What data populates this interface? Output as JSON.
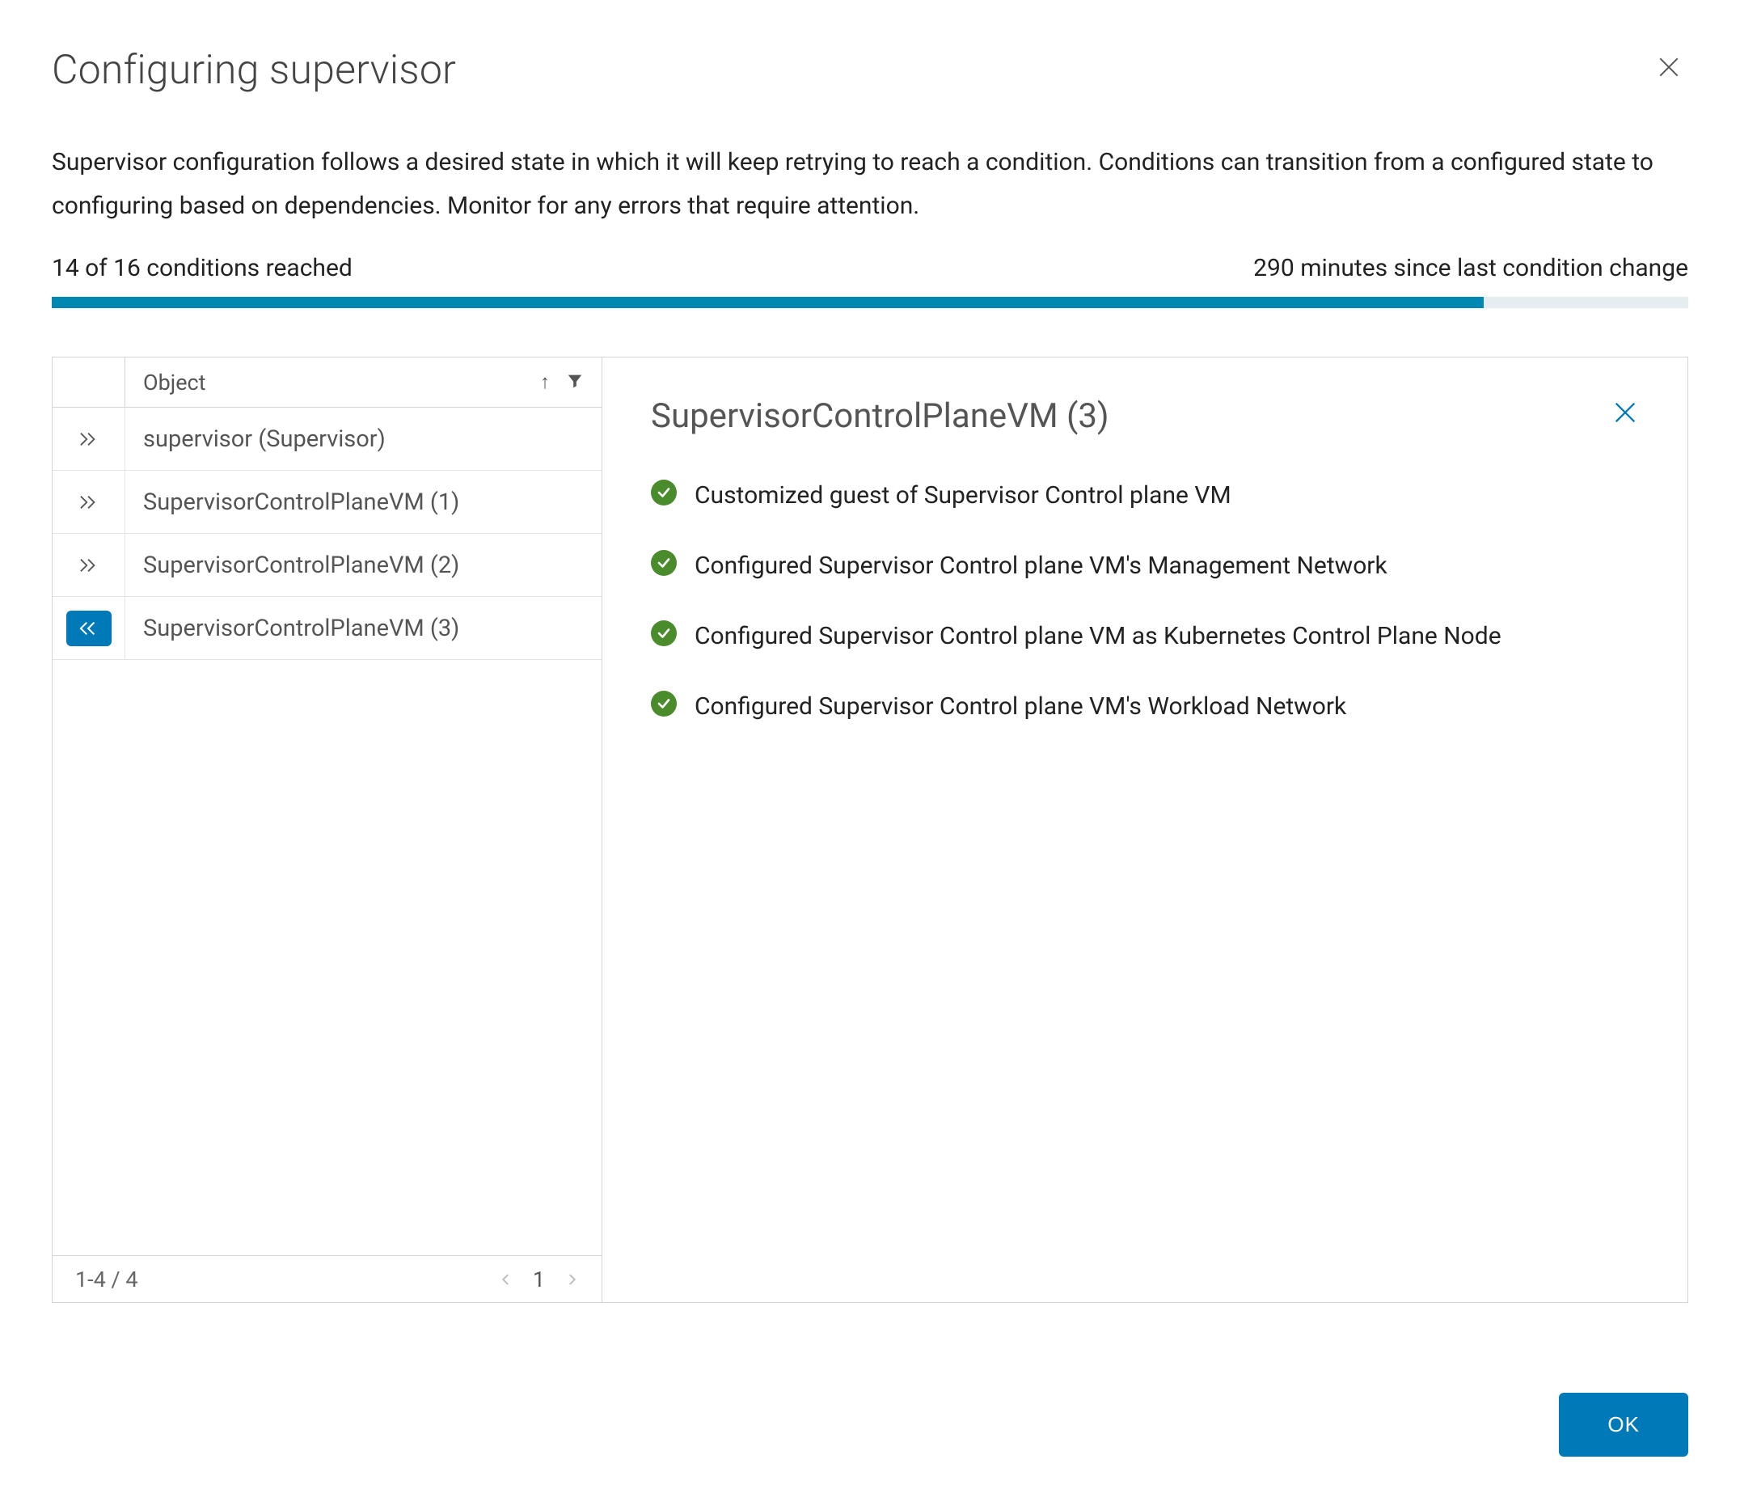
{
  "title": "Configuring supervisor",
  "description": "Supervisor configuration follows a desired state in which it will keep retrying to reach a condition. Conditions can transition from a configured state to configuring based on dependencies. Monitor for any errors that require attention.",
  "progress": {
    "leftLabel": "14 of 16 conditions reached",
    "rightLabel": "290 minutes since last condition change",
    "percent": 87.5
  },
  "table": {
    "header": "Object",
    "rows": [
      {
        "label": "supervisor (Supervisor)",
        "selected": false
      },
      {
        "label": "SupervisorControlPlaneVM (1)",
        "selected": false
      },
      {
        "label": "SupervisorControlPlaneVM (2)",
        "selected": false
      },
      {
        "label": "SupervisorControlPlaneVM (3)",
        "selected": true
      }
    ],
    "footer": {
      "range": "1-4 / 4",
      "page": "1"
    }
  },
  "detail": {
    "title": "SupervisorControlPlaneVM (3)",
    "conditions": [
      "Customized guest of Supervisor Control plane VM",
      "Configured Supervisor Control plane VM's Management Network",
      "Configured Supervisor Control plane VM as Kubernetes Control Plane Node",
      "Configured Supervisor Control plane VM's Workload Network"
    ]
  },
  "okLabel": "OK"
}
